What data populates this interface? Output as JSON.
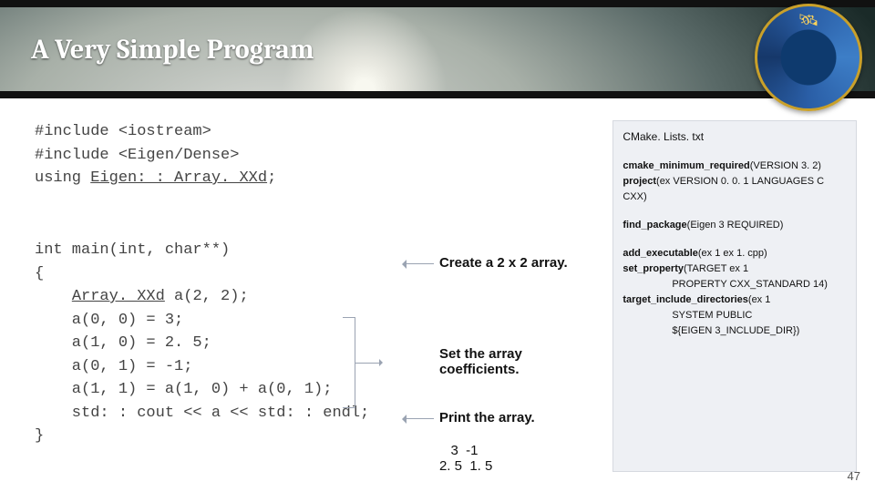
{
  "slide": {
    "title": "A Very Simple Program",
    "page_number": "47"
  },
  "code": {
    "inc1": "#include <iostream>",
    "inc2": "#include <Eigen/Dense>",
    "using_prefix": "using ",
    "using_type": "Eigen: : Array. XXd",
    "using_suffix": ";",
    "main_sig": "int main(int, char**)",
    "brace_open": "{",
    "decl_prefix": "    ",
    "decl_type": "Array. XXd",
    "decl_rest": " a(2, 2);",
    "l1": "    a(0, 0) = 3;",
    "l2": "    a(1, 0) = 2. 5;",
    "l3": "    a(0, 1) = -1;",
    "l4": "    a(1, 1) = a(1, 0) + a(0, 1);",
    "l5": "    std: : cout << a << std: : endl;",
    "brace_close": "}"
  },
  "annotations": {
    "create": "Create a 2 x 2 array.",
    "set": "Set the array\ncoefficients.",
    "print": "Print the array.",
    "out_line1": "   3  -1",
    "out_line2": "2. 5  1. 5"
  },
  "cmake": {
    "filename": "CMake. Lists. txt",
    "min_req": "cmake_minimum_required",
    "min_req_args": "(VERSION 3. 2)",
    "project": "project",
    "project_args": "(ex VERSION 0. 0. 1 LANGUAGES C CXX)",
    "find_pkg": "find_package",
    "find_pkg_args": "(Eigen 3 REQUIRED)",
    "add_exe": "add_executable",
    "add_exe_args": "(ex 1 ex 1. cpp)",
    "set_prop": "set_property",
    "set_prop_args1": "(TARGET ex 1",
    "set_prop_args2": "PROPERTY CXX_STANDARD 14)",
    "tgt_inc": "target_include_directories",
    "tgt_inc_args1": "(ex 1",
    "tgt_inc_args2": "SYSTEM PUBLIC",
    "tgt_inc_args3": "${EIGEN 3_INCLUDE_DIR})"
  }
}
